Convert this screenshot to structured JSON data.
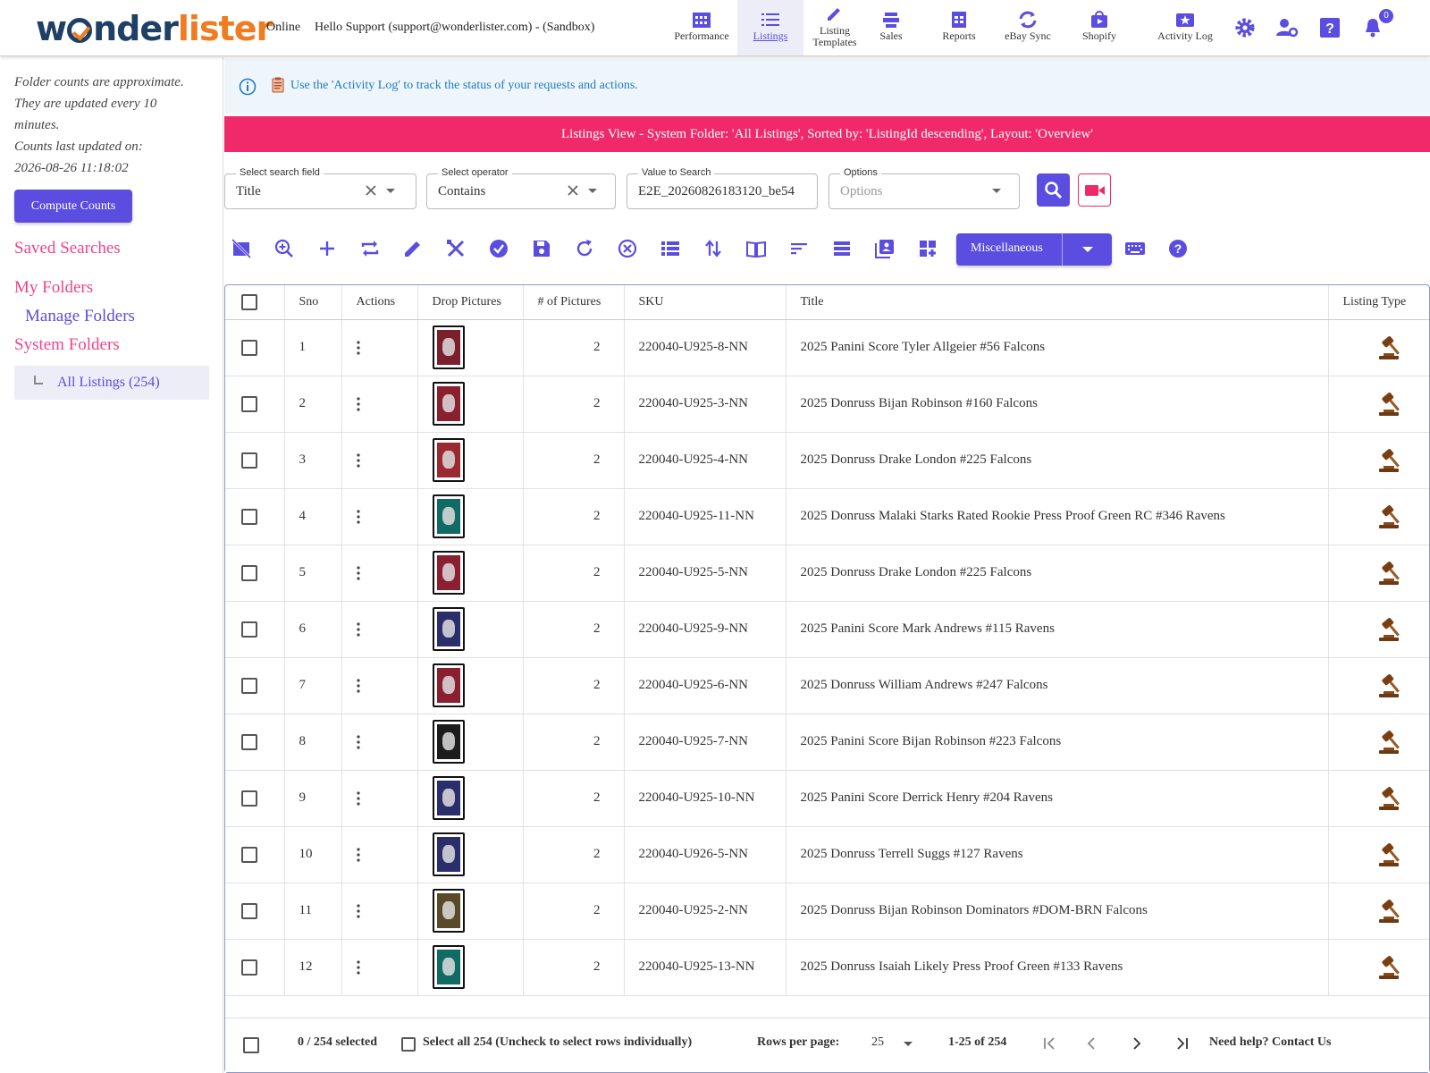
{
  "header": {
    "logo_part1": "w",
    "logo_part2": "nder",
    "logo_part3": "lister",
    "status": "Online",
    "greeting": "Hello Support (support@wonderlister.com) - (Sandbox)",
    "nav": [
      {
        "label": "Performance",
        "icon": "performance-icon"
      },
      {
        "label": "Listings",
        "icon": "listings-icon",
        "active": true
      },
      {
        "label": "Listing Templates",
        "icon": "listing-templates-icon"
      },
      {
        "label": "Sales",
        "icon": "sales-icon"
      },
      {
        "label": "Reports",
        "icon": "reports-icon"
      },
      {
        "label": "eBay Sync",
        "icon": "ebay-sync-icon"
      },
      {
        "label": "Shopify",
        "icon": "shopify-icon"
      },
      {
        "label": "Activity Log",
        "icon": "activity-log-icon"
      }
    ],
    "notifications_count": "0"
  },
  "sidebar": {
    "note_line1": "Folder counts are approximate.",
    "note_line2": "They are updated every 10",
    "note_line3": "minutes.",
    "note_line4": "Counts last updated on:",
    "note_line5": "2026-08-26 11:18:02",
    "compute_button": "Compute Counts",
    "saved_searches": "Saved Searches",
    "my_folders": "My Folders",
    "manage_folders": "Manage Folders",
    "system_folders": "System Folders",
    "folder_item": "All Listings (254)"
  },
  "info": {
    "text": "Use the 'Activity Log' to track the status of your requests and actions."
  },
  "view_banner": "Listings View - System Folder: 'All Listings', Sorted by: 'ListingId descending', Layout: 'Overview'",
  "filters": {
    "search_field_label": "Select search field",
    "search_field_value": "Title",
    "operator_label": "Select operator",
    "operator_value": "Contains",
    "value_label": "Value to Search",
    "value_value": "E2E_20260826183120_be54",
    "options_label": "Options",
    "options_placeholder": "Options"
  },
  "toolbar": {
    "misc_label": "Miscellaneous"
  },
  "table": {
    "columns": [
      "Sno",
      "Actions",
      "Drop Pictures",
      "# of Pictures",
      "SKU",
      "Title",
      "Listing Type"
    ],
    "rows": [
      {
        "sno": "1",
        "pics": "2",
        "sku": "220040-U925-8-NN",
        "title": "2025 Panini Score Tyler Allgeier #56 Falcons"
      },
      {
        "sno": "2",
        "pics": "2",
        "sku": "220040-U925-3-NN",
        "title": "2025 Donruss Bijan Robinson #160 Falcons"
      },
      {
        "sno": "3",
        "pics": "2",
        "sku": "220040-U925-4-NN",
        "title": "2025 Donruss Drake London #225 Falcons"
      },
      {
        "sno": "4",
        "pics": "2",
        "sku": "220040-U925-11-NN",
        "title": "2025 Donruss Malaki Starks Rated Rookie Press Proof Green RC #346 Ravens"
      },
      {
        "sno": "5",
        "pics": "2",
        "sku": "220040-U925-5-NN",
        "title": "2025 Donruss Drake London #225 Falcons"
      },
      {
        "sno": "6",
        "pics": "2",
        "sku": "220040-U925-9-NN",
        "title": "2025 Panini Score Mark Andrews #115 Ravens"
      },
      {
        "sno": "7",
        "pics": "2",
        "sku": "220040-U925-6-NN",
        "title": "2025 Donruss William Andrews #247 Falcons"
      },
      {
        "sno": "8",
        "pics": "2",
        "sku": "220040-U925-7-NN",
        "title": "2025 Panini Score Bijan Robinson #223 Falcons"
      },
      {
        "sno": "9",
        "pics": "2",
        "sku": "220040-U925-10-NN",
        "title": "2025 Panini Score Derrick Henry #204 Ravens"
      },
      {
        "sno": "10",
        "pics": "2",
        "sku": "220040-U926-5-NN",
        "title": "2025 Donruss Terrell Suggs #127 Ravens"
      },
      {
        "sno": "11",
        "pics": "2",
        "sku": "220040-U925-2-NN",
        "title": "2025 Donruss Bijan Robinson Dominators #DOM-BRN Falcons"
      },
      {
        "sno": "12",
        "pics": "2",
        "sku": "220040-U925-13-NN",
        "title": "2025 Donruss Isaiah Likely Press Proof Green #133 Ravens"
      }
    ],
    "thumb_colors": [
      "#7a1f2b",
      "#8a1f2f",
      "#9a2a30",
      "#0f6b63",
      "#8a1f2f",
      "#2a2f6b",
      "#8a1f2f",
      "#1c1c1c",
      "#2a2f6b",
      "#2a2f6b",
      "#5a4a2a",
      "#0f6b63"
    ]
  },
  "footer": {
    "selected": "0 / 254 selected",
    "select_all": "Select all 254 (Uncheck to select rows individually)",
    "rows_per_page_label": "Rows per page:",
    "rows_per_page_value": "25",
    "range": "1-25 of 254",
    "help": "Need help? Contact Us"
  },
  "colors": {
    "accent": "#5b4de0",
    "pink": "#f0296a",
    "info": "#1f7ac7"
  }
}
